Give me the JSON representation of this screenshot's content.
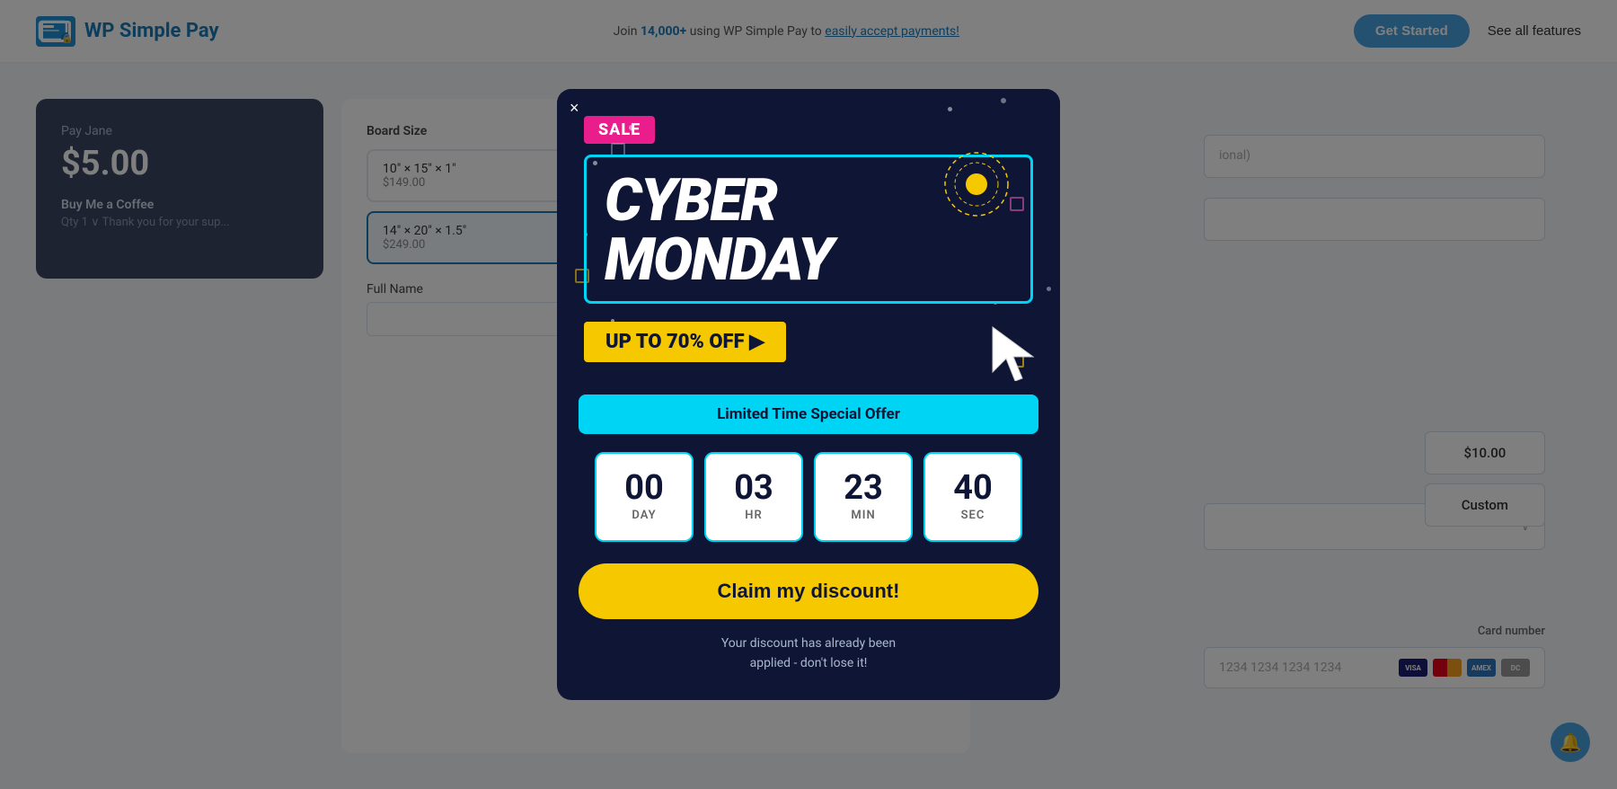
{
  "header": {
    "logo_text": "WP Simple Pay",
    "promo_text": "Join ",
    "promo_count": "14,000+",
    "promo_mid": " using WP Simple Pay to ",
    "promo_link": "easily accept payments!",
    "get_started_label": "Get Started",
    "see_features_label": "See all features"
  },
  "background": {
    "pay_jane_label": "Pay Jane",
    "pay_jane_amount": "$5.00",
    "product_name": "Buy Me a Coffee",
    "qty_text": "Qty  1 ∨  Thank you for your sup...",
    "board_size_label": "Board Size",
    "option1_name": "10\" × 15\" × 1\"",
    "option1_price": "$149.00",
    "option2_name": "14\" × 20\" × 1.5\"",
    "option2_price": "$249.00",
    "full_name_label": "Full Name",
    "amount_10": "$10.00",
    "amount_custom": "Custom",
    "card_number_label": "Card number",
    "card_number_placeholder": "1234 1234 1234 1234",
    "optional_text": "ional)",
    "bell_icon": "🔔"
  },
  "modal": {
    "close_label": "×",
    "sale_badge": "SALE",
    "cyber_line1": "CYBER",
    "cyber_line2": "MONDAY",
    "discount_text": "UP TO 70% OFF ▶",
    "limited_offer": "Limited Time Special Offer",
    "countdown": {
      "days_value": "00",
      "days_label": "DAY",
      "hours_value": "03",
      "hours_label": "HR",
      "minutes_value": "23",
      "minutes_label": "MIN",
      "seconds_value": "40",
      "seconds_label": "SEC"
    },
    "cta_label": "Claim my discount!",
    "discount_applied_line1": "Your discount has already been",
    "discount_applied_line2": "applied - don't lose it!",
    "accent_color": "#00d4f5",
    "bg_color": "#0e1535",
    "badge_color": "#e91e8c",
    "cta_color": "#f5c800"
  }
}
